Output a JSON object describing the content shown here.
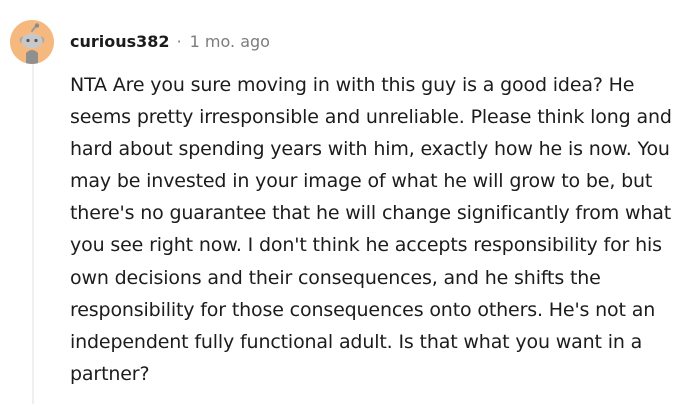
{
  "comment": {
    "author": {
      "avatar_icon": "reddit-snoo-avatar-icon",
      "avatar_bg": "#F5B97F",
      "username": "curious382"
    },
    "meta": {
      "separator": "·",
      "timestamp": "1 mo. ago"
    },
    "body": "NTA Are you sure moving in with this guy is a good idea? He seems pretty irresponsible and unreliable. Please think long and hard about spending years with him, exactly how he is now. You may be invested in your image of what he will grow to be, but there's no guarantee that he will change significantly from what you see right now. I don't think he accepts responsibility for his own decisions and their consequences, and he shifts the responsibility for those consequences onto others. He's not an independent fully functional adult. Is that what you want in a partner?"
  }
}
